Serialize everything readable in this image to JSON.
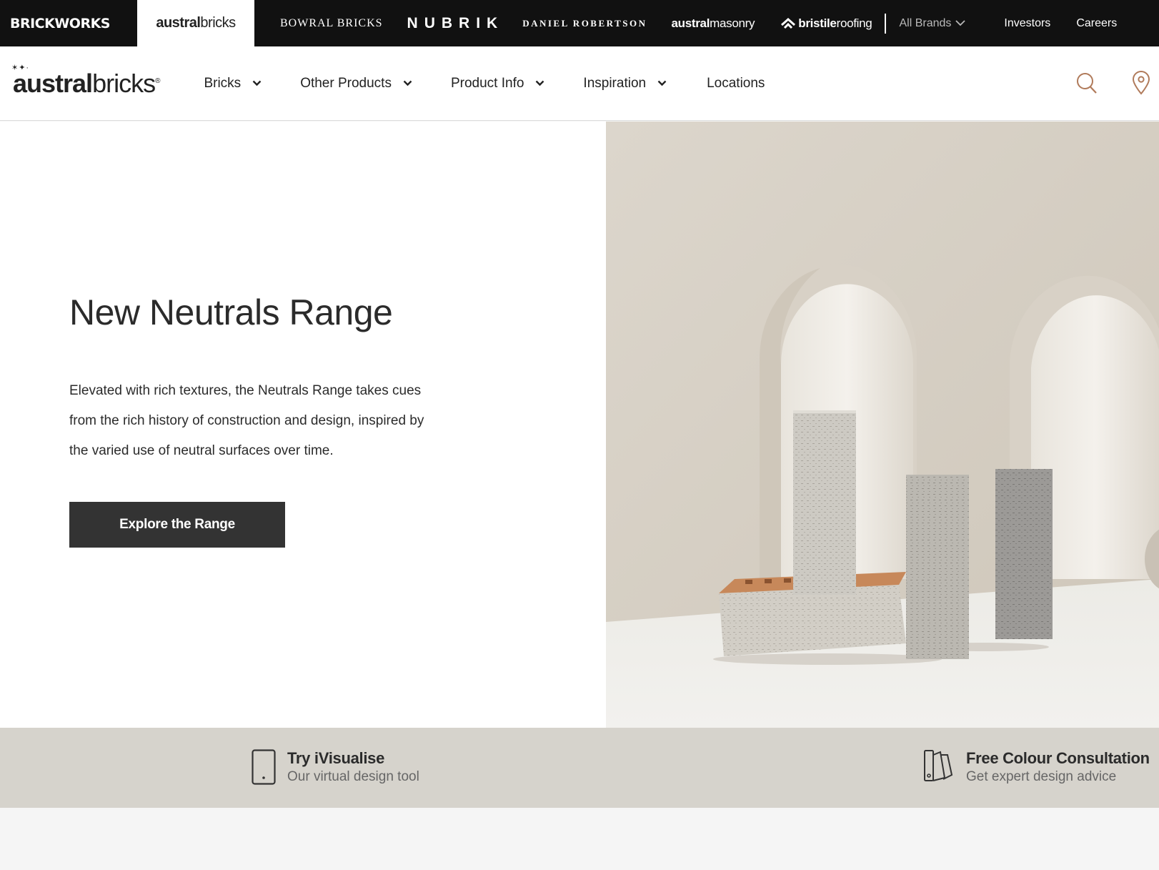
{
  "brandbar": {
    "brickworks": "BRICKWORKS",
    "austral_a": "austral",
    "austral_b": "bricks",
    "bowral": "BOWRAL BRICKS",
    "nubrik": "NUBRIK",
    "daniel": "DANIEL ROBERTSON",
    "masonry_a": "austral",
    "masonry_b": "masonry",
    "bristile_a": "bristile",
    "bristile_b": "roofing",
    "all_brands": "All Brands",
    "investors": "Investors",
    "careers": "Careers"
  },
  "logo": {
    "part_a": "austral",
    "part_b": "bricks"
  },
  "nav": {
    "bricks": "Bricks",
    "other_products": "Other Products",
    "product_info": "Product Info",
    "inspiration": "Inspiration",
    "locations": "Locations"
  },
  "hero": {
    "title": "New Neutrals Range",
    "body": "Elevated with rich textures, the Neutrals Range takes cues from the rich history of construction and design, inspired by the varied use of neutral surfaces over time.",
    "button": "Explore the Range"
  },
  "promos": {
    "visualise_title": "Try iVisualise",
    "visualise_sub": "Our virtual design tool",
    "consult_title": "Free Colour Consultation",
    "consult_sub": "Get expert design advice"
  },
  "icons": {
    "search": "search-icon",
    "pin": "location-pin-icon",
    "tablet": "tablet-icon",
    "swatch": "colour-swatch-icon",
    "chevron": "chevron-down-icon"
  },
  "colors": {
    "brandbar_bg": "#111111",
    "button_bg": "#333333",
    "strip_bg": "#d6d3cc",
    "accent_icon": "#b07a5a"
  }
}
